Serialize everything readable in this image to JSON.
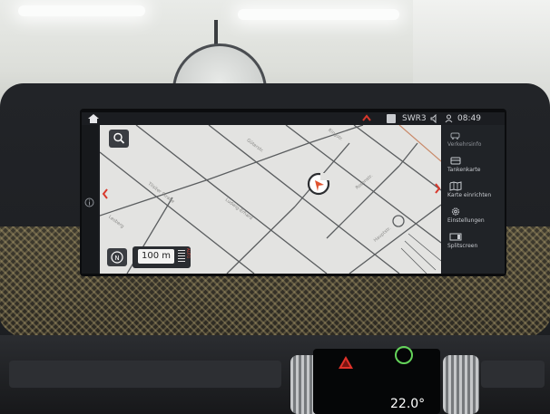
{
  "status_bar": {
    "radio_source": "SWR3",
    "clock": "08:49"
  },
  "map": {
    "scale_value": "100 m",
    "scale_mode": "AUTO",
    "street_labels": [
      "Tilsiter Straße",
      "Ludwig-Erhard",
      "Güterstr.",
      "Lesberg",
      "Rosenstr.",
      "Hauptstr.",
      "Ringstr."
    ]
  },
  "side_menu": {
    "items": [
      {
        "label": "Verkehrsinfo",
        "icon": "traffic-info-icon"
      },
      {
        "label": "Tankenkarte",
        "icon": "fuel-card-icon"
      },
      {
        "label": "Karte einrichten",
        "icon": "map-settings-icon"
      },
      {
        "label": "Einstellungen",
        "icon": "gear-icon"
      },
      {
        "label": "Splitscreen",
        "icon": "splitscreen-icon"
      }
    ]
  },
  "console": {
    "temperature": "22.0°"
  },
  "colors": {
    "screen_bg": "#1a1c20",
    "map_bg": "#e3e3e1",
    "road": "#5a5d5f",
    "accent_red": "#d8382c",
    "position_marker": "#e0532f"
  }
}
